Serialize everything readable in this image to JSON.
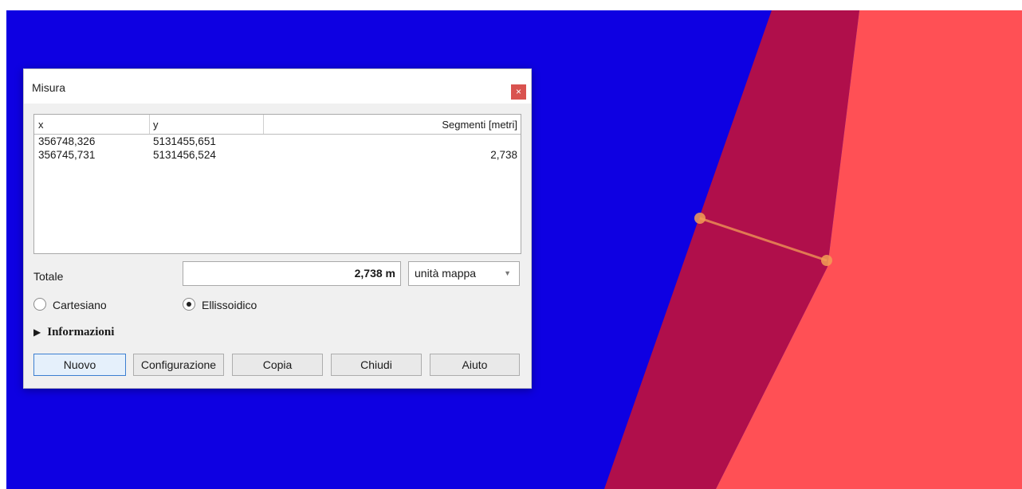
{
  "colors": {
    "map_background": "#0e00e2",
    "polygon_dark": "#b00f4b",
    "polygon_light": "#ff5055",
    "measure_line": "#f29e55"
  },
  "dialog": {
    "title": "Misura",
    "close_icon": "×",
    "table": {
      "headers": [
        "x",
        "y",
        "Segmenti [metri]"
      ],
      "rows": [
        {
          "x": "356748,326",
          "y": "5131455,651",
          "segment": ""
        },
        {
          "x": "356745,731",
          "y": "5131456,524",
          "segment": "2,738"
        }
      ]
    },
    "total": {
      "label": "Totale",
      "value": "2,738 m",
      "unit_selected": "unità mappa",
      "unit_arrow": "▼"
    },
    "modes": [
      {
        "label": "Cartesiano",
        "selected": false
      },
      {
        "label": "Ellissoidico",
        "selected": true
      }
    ],
    "info": {
      "icon": "▶",
      "label": "Informazioni"
    },
    "buttons": {
      "nuovo": "Nuovo",
      "configurazione": "Configurazione",
      "copia": "Copia",
      "chiudi": "Chiudi",
      "aiuto": "Aiuto"
    }
  }
}
